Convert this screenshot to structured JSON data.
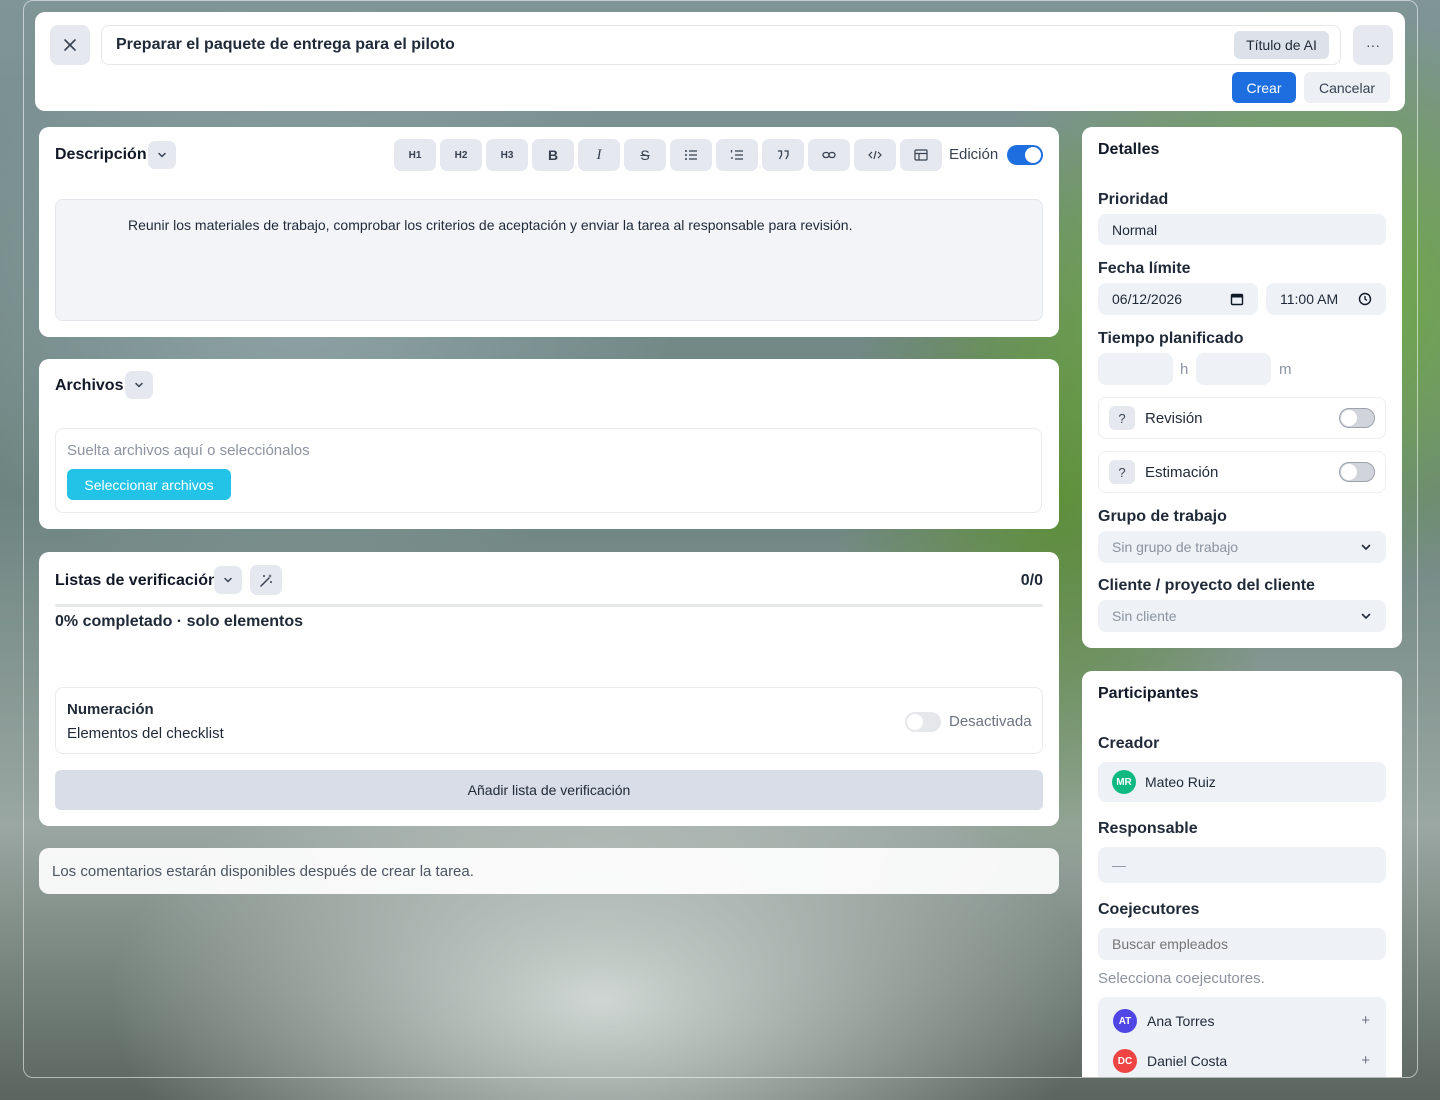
{
  "header": {
    "title_value": "Preparar el paquete de entrega para el piloto",
    "ai_title_label": "Título de AI",
    "create_label": "Crear",
    "cancel_label": "Cancelar",
    "more_label": "···"
  },
  "description": {
    "title": "Descripción",
    "toolbar": [
      "H1",
      "H2",
      "H3",
      "B",
      "I",
      "S"
    ],
    "edit_label": "Edición",
    "edit_on": true,
    "text": "Reunir los materiales de trabajo, comprobar los criterios de aceptación y enviar la tarea al responsable para revisión."
  },
  "files": {
    "title": "Archivos",
    "dropzone_text": "Suelta archivos aquí o selecciónalos",
    "select_label": "Seleccionar archivos"
  },
  "checklists": {
    "title": "Listas de verificación",
    "count": "0/0",
    "progress_text": "0% completado · solo elementos",
    "progress": 0,
    "numbering_title": "Numeración",
    "numbering_subtitle": "Elementos del checklist",
    "numbering_state": "Desactivada",
    "add_label": "Añadir lista de verificación"
  },
  "comments_note": "Los comentarios estarán disponibles después de crear la tarea.",
  "details": {
    "title": "Detalles",
    "priority_label": "Prioridad",
    "priority_value": "Normal",
    "due_label": "Fecha límite",
    "due_date": "06/12/2026",
    "due_time": "11:00 AM",
    "planned_label": "Tiempo planificado",
    "hours_unit": "h",
    "minutes_unit": "m",
    "review_label": "Revisión",
    "estimation_label": "Estimación",
    "help_glyph": "?",
    "group_label": "Grupo de trabajo",
    "group_value": "Sin grupo de trabajo",
    "client_label": "Cliente / proyecto del cliente",
    "client_value": "Sin cliente"
  },
  "participants": {
    "title": "Participantes",
    "creator_label": "Creador",
    "creator_initials": "MR",
    "creator_name": "Mateo Ruiz",
    "responsible_label": "Responsable",
    "responsible_value": "—",
    "coexec_label": "Coejecutores",
    "search_placeholder": "Buscar empleados",
    "hint": "Selecciona coejecutores.",
    "plus": "+",
    "people": [
      {
        "initials": "AT",
        "name": "Ana Torres",
        "color": "#4f46e5"
      },
      {
        "initials": "DC",
        "name": "Daniel Costa",
        "color": "#ef4444"
      }
    ],
    "creator_color": "#10b981"
  },
  "colors": {
    "primary": "#1d6fe0",
    "cyan": "#22c3e6"
  }
}
